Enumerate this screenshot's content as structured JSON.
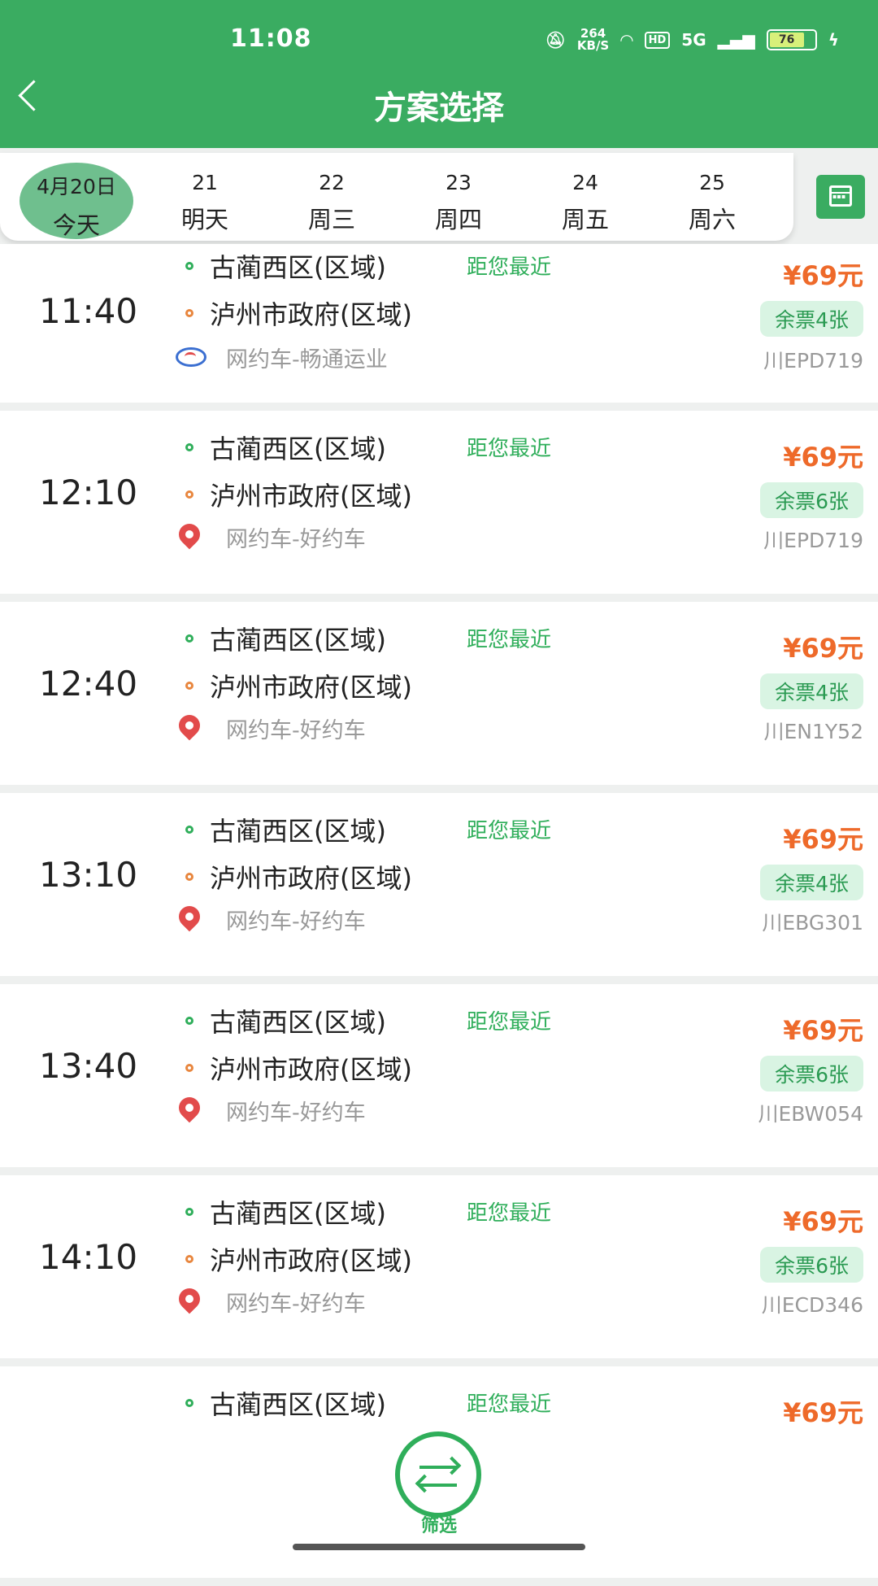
{
  "status": {
    "time": "11:08",
    "net_speed_value": "264",
    "net_speed_unit": "KB/S",
    "network": "5G",
    "battery": "76"
  },
  "header": {
    "title": "方案选择"
  },
  "dates": [
    {
      "num": "4月20日",
      "week": "今天",
      "selected": true
    },
    {
      "num": "21",
      "week": "明天"
    },
    {
      "num": "22",
      "week": "周三"
    },
    {
      "num": "23",
      "week": "周四"
    },
    {
      "num": "24",
      "week": "周五"
    },
    {
      "num": "25",
      "week": "周六"
    }
  ],
  "trips": [
    {
      "time": "11:40",
      "from": "古蔺西区(区域)",
      "near": "距您最近",
      "to": "泸州市政府(区域)",
      "operator": "网约车-畅通运业",
      "price": "¥69元",
      "seats": "余票4张",
      "plate": "川EPD719"
    },
    {
      "time": "12:10",
      "from": "古蔺西区(区域)",
      "near": "距您最近",
      "to": "泸州市政府(区域)",
      "operator": "网约车-好约车",
      "price": "¥69元",
      "seats": "余票6张",
      "plate": "川EPD719"
    },
    {
      "time": "12:40",
      "from": "古蔺西区(区域)",
      "near": "距您最近",
      "to": "泸州市政府(区域)",
      "operator": "网约车-好约车",
      "price": "¥69元",
      "seats": "余票4张",
      "plate": "川EN1Y52"
    },
    {
      "time": "13:10",
      "from": "古蔺西区(区域)",
      "near": "距您最近",
      "to": "泸州市政府(区域)",
      "operator": "网约车-好约车",
      "price": "¥69元",
      "seats": "余票4张",
      "plate": "川EBG301"
    },
    {
      "time": "13:40",
      "from": "古蔺西区(区域)",
      "near": "距您最近",
      "to": "泸州市政府(区域)",
      "operator": "网约车-好约车",
      "price": "¥69元",
      "seats": "余票6张",
      "plate": "川EBW054"
    },
    {
      "time": "14:10",
      "from": "古蔺西区(区域)",
      "near": "距您最近",
      "to": "泸州市政府(区域)",
      "operator": "网约车-好约车",
      "price": "¥69元",
      "seats": "余票6张",
      "plate": "川ECD346"
    },
    {
      "from": "古蔺西区(区域)",
      "near": "距您最近",
      "price": "¥69元"
    }
  ],
  "filter": {
    "label": "筛选"
  }
}
